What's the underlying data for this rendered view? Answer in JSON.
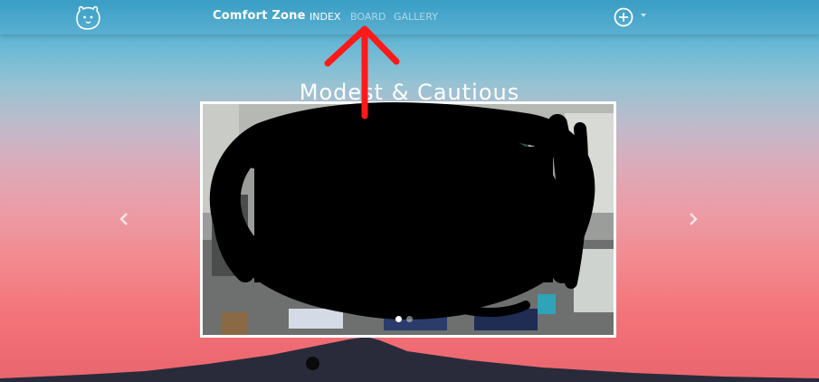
{
  "navbar": {
    "logo_icon": "bear-face-icon",
    "brand": "Comfort Zone",
    "links": [
      {
        "label": "INDEX",
        "active": true
      },
      {
        "label": "BOARD",
        "active": false
      },
      {
        "label": "GALLERY",
        "active": false
      }
    ],
    "add_icon": "plus-circle-icon",
    "caret_icon": "caret-down-icon"
  },
  "main": {
    "title": "Modest & Cautious"
  },
  "carousel": {
    "prev_icon": "chevron-left-icon",
    "next_icon": "chevron-right-icon",
    "slide_count": 2,
    "active_slide": 1
  },
  "colors": {
    "annotation_arrow": "#ff1a1a",
    "redaction": "#000000",
    "sky_top": "#37a7cf",
    "sky_bottom": "#ef6a72"
  }
}
